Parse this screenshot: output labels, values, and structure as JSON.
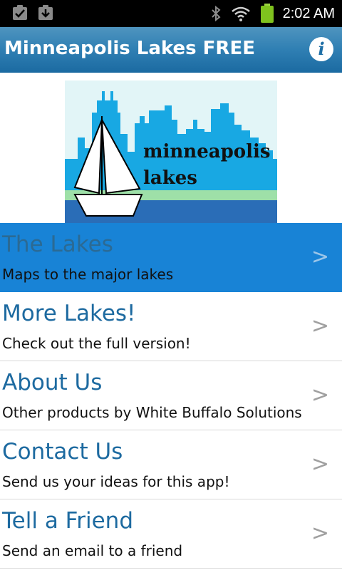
{
  "status_bar": {
    "time": "2:02 AM",
    "icons": [
      "checkbox-icon",
      "download-icon",
      "bluetooth-icon",
      "wifi-icon",
      "battery-icon"
    ]
  },
  "app": {
    "title": "Minneapolis Lakes FREE",
    "info_icon": "info-icon",
    "accent_color": "#1883d6",
    "header_color": "#2f7fb3"
  },
  "banner": {
    "line1": "minneapolis",
    "line2": "lakes"
  },
  "menu": {
    "items": [
      {
        "title": "The Lakes",
        "subtitle": "Maps to the major lakes",
        "chevron": ">",
        "selected": true
      },
      {
        "title": "More Lakes!",
        "subtitle": "Check out the full version!",
        "chevron": ">"
      },
      {
        "title": "About Us",
        "subtitle": "Other products by White Buffalo Solutions",
        "chevron": ">"
      },
      {
        "title": "Contact Us",
        "subtitle": "Send us your ideas for this app!",
        "chevron": ">"
      },
      {
        "title": "Tell a Friend",
        "subtitle": "Send an email to a friend",
        "chevron": ">"
      }
    ]
  }
}
